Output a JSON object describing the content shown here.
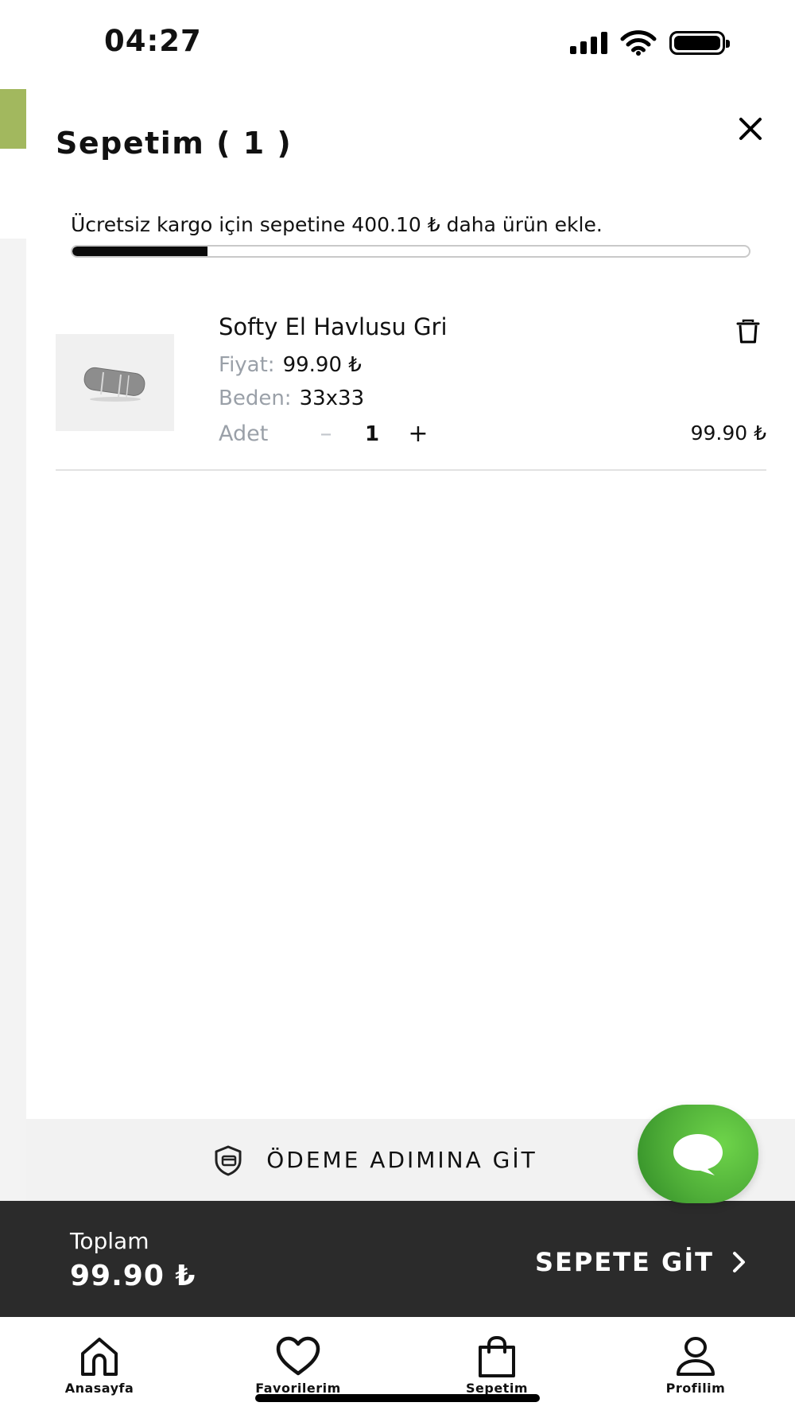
{
  "status_bar": {
    "time": "04:27"
  },
  "cart": {
    "title": "Sepetim ( 1 )",
    "shipping_notice": "Ücretsiz kargo için sepetine 400.10 ₺ daha ürün ekle.",
    "shipping_progress": 0.2,
    "items": [
      {
        "name": "Softy El Havlusu Gri",
        "price_label": "Fiyat:",
        "price": "99.90 ₺",
        "size_label": "Beden:",
        "size": "33x33",
        "qty_label": "Adet",
        "qty_minus": "–",
        "qty": "1",
        "qty_plus": "+",
        "line_total": "99.90 ₺"
      }
    ]
  },
  "checkout": {
    "label": "ÖDEME ADIMINA GİT"
  },
  "summary": {
    "total_label": "Toplam",
    "total_value": "99.90 ₺",
    "go_cart_label": "SEPETE GİT"
  },
  "nav": {
    "items": [
      {
        "label": "Anasayfa",
        "icon": "home-icon"
      },
      {
        "label": "Favorilerim",
        "icon": "heart-icon"
      },
      {
        "label": "Sepetim",
        "icon": "bag-icon"
      },
      {
        "label": "Profilim",
        "icon": "profile-icon"
      }
    ]
  },
  "colors": {
    "accent_green": "#4fae38",
    "dark_bar": "#2b2b2b",
    "muted_label": "#9aa0a8"
  }
}
